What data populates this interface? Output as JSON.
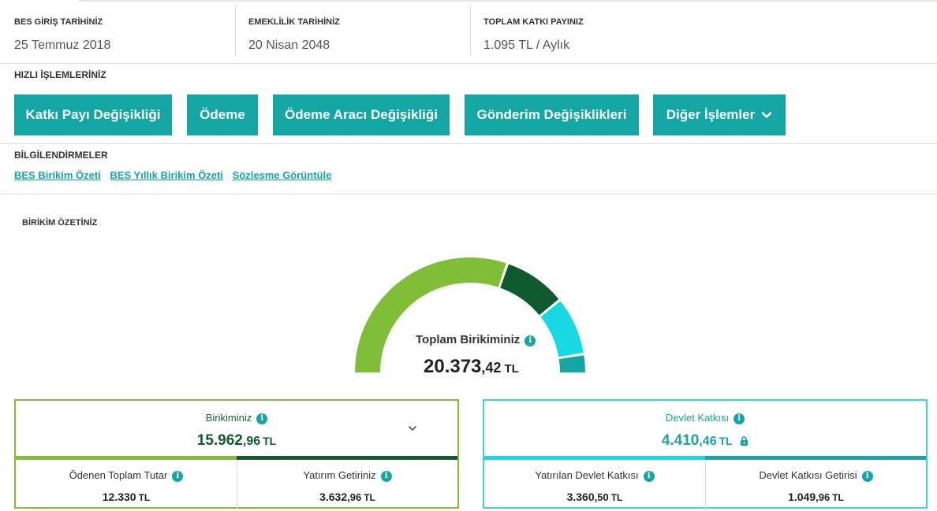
{
  "header": {
    "bes_start_label": "BES GİRİŞ TARİHİNİZ",
    "bes_start_value": "25 Temmuz 2018",
    "retirement_label": "EMEKLİLİK TARİHİNİZ",
    "retirement_value": "20 Nisan 2048",
    "contribution_label": "TOPLAM KATKI PAYINIZ",
    "contribution_value": "1.095 TL / Aylık"
  },
  "quick_actions": {
    "title": "HIZLI İŞLEMLERİNİZ",
    "buttons": [
      "Katkı Payı Değişikliği",
      "Ödeme",
      "Ödeme Aracı Değişikliği",
      "Gönderim Değişiklikleri",
      "Diğer İşlemler"
    ]
  },
  "info": {
    "title": "BİLGİLENDİRMELER",
    "links": [
      "BES Birikim Özeti",
      "BES Yıllık Birikim Özeti",
      "Sözleşme Görüntüle"
    ]
  },
  "summary": {
    "title": "BİRİKİM ÖZETİNİZ",
    "total_label": "Toplam Birikiminiz",
    "total_int": "20.373",
    "total_dec": ",42",
    "currency": "TL",
    "gauge_segments": [
      {
        "name": "Ödenen Toplam Tutar",
        "value": 12330,
        "color": "#7fbe36"
      },
      {
        "name": "Yatırım Getiriniz",
        "value": 3632.96,
        "color": "#0f5a2e"
      },
      {
        "name": "Yatırılan Devlet Katkısı",
        "value": 3360.5,
        "color": "#17d9e3"
      },
      {
        "name": "Devlet Katkısı Getirisi",
        "value": 1049.96,
        "color": "#13a6a3"
      }
    ]
  },
  "savings_card": {
    "label": "Birikiminiz",
    "value_int": "15.962",
    "value_dec": ",96",
    "currency": "TL",
    "bar_colors": [
      "#7fbe36",
      "#0f5a2e"
    ],
    "sub": [
      {
        "label": "Ödenen Toplam Tutar",
        "int": "12.330",
        "dec": "",
        "currency": "TL"
      },
      {
        "label": "Yatırım Getiriniz",
        "int": "3.632",
        "dec": ",96",
        "currency": "TL"
      }
    ]
  },
  "state_card": {
    "label": "Devlet Katkısı",
    "value_int": "4.410",
    "value_dec": ",46",
    "currency": "TL",
    "bar_colors": [
      "#17d9e3",
      "#13a6a3"
    ],
    "sub": [
      {
        "label": "Yatırılan Devlet Katkısı",
        "int": "3.360",
        "dec": ",50",
        "currency": "TL"
      },
      {
        "label": "Devlet Katkısı Getirisi",
        "int": "1.049",
        "dec": ",96",
        "currency": "TL"
      }
    ]
  }
}
